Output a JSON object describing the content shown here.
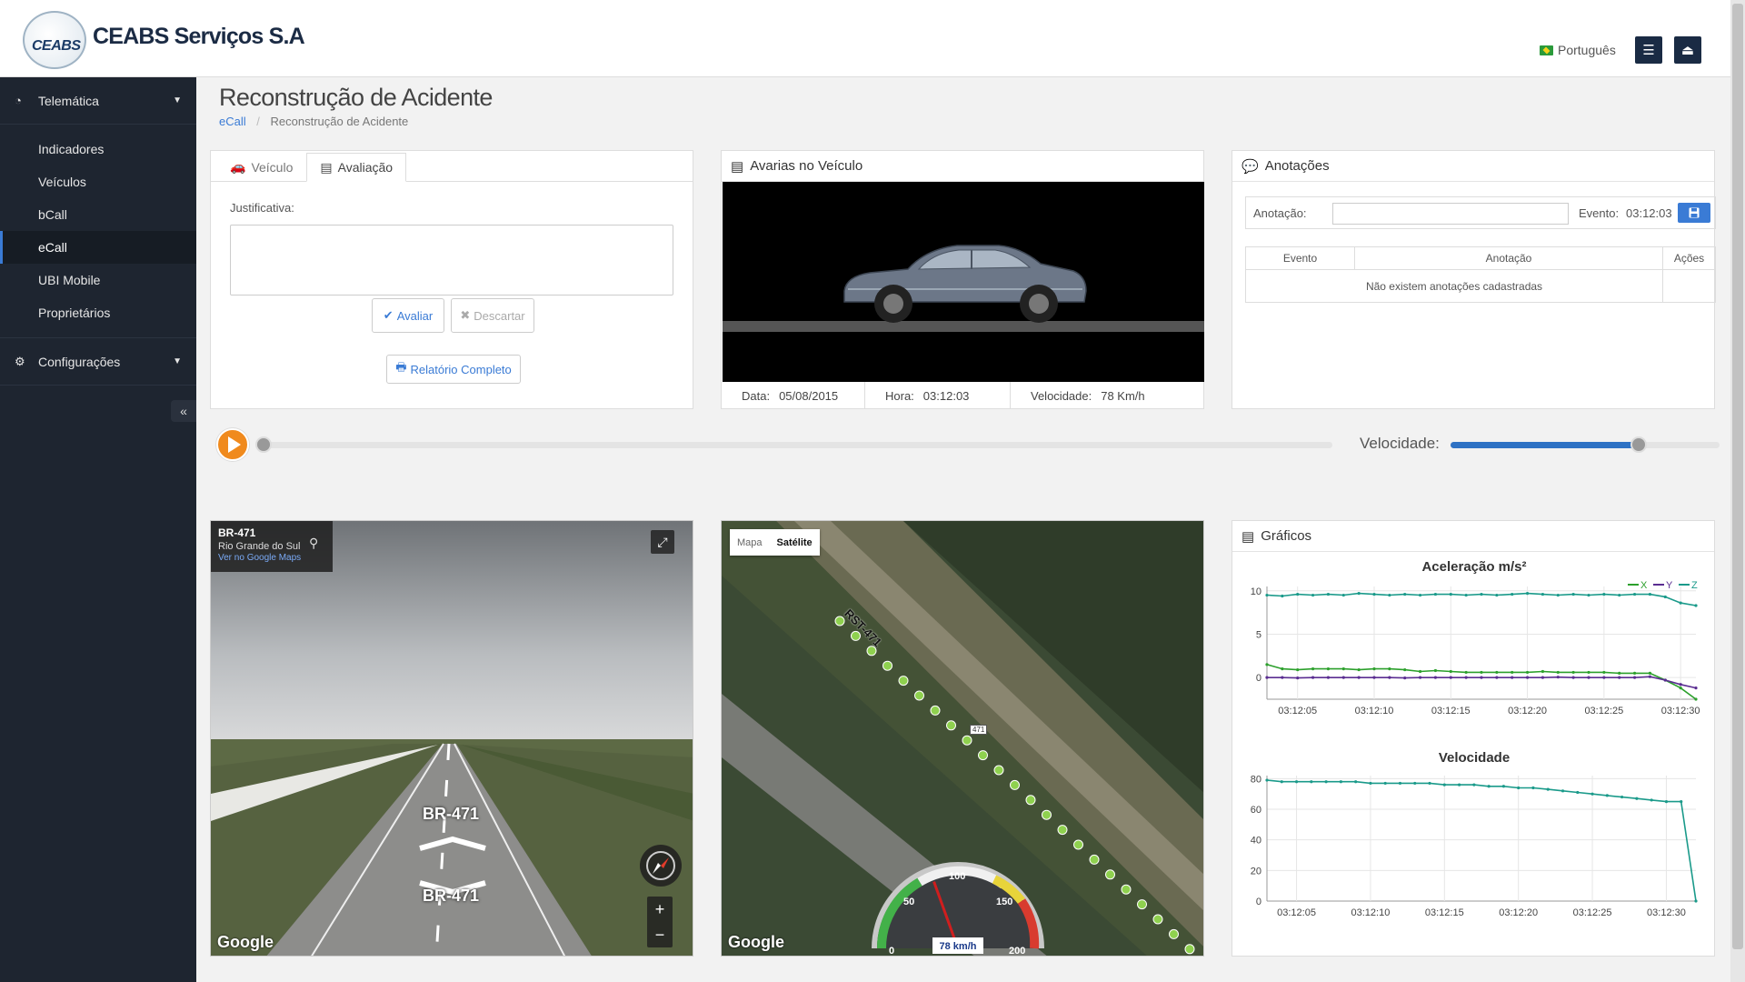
{
  "header": {
    "logo_text": "CEABS",
    "company": "CEABS Serviços S.A",
    "language": "Português"
  },
  "sidebar": {
    "sections": [
      {
        "label": "Telemática",
        "icon": "dashboard-icon"
      },
      {
        "label": "Configurações",
        "icon": "cogs-icon"
      }
    ],
    "items": [
      "Indicadores",
      "Veículos",
      "bCall",
      "eCall",
      "UBI Mobile",
      "Proprietários"
    ],
    "active_item": "eCall"
  },
  "page": {
    "title": "Reconstrução de Acidente",
    "breadcrumb": [
      "eCall",
      "Reconstrução de Acidente"
    ]
  },
  "evaluation": {
    "tabs": [
      "Veículo",
      "Avaliação"
    ],
    "active_tab": "Avaliação",
    "justification_label": "Justificativa:",
    "justification_value": "",
    "evaluate_label": "Avaliar",
    "discard_label": "Descartar",
    "report_label": "Relatório Completo"
  },
  "damage": {
    "title": "Avarias no Veículo",
    "date_label": "Data:",
    "date_value": "05/08/2015",
    "time_label": "Hora:",
    "time_value": "03:12:03",
    "speed_label": "Velocidade:",
    "speed_value": "78 Km/h"
  },
  "annotations": {
    "title": "Anotações",
    "input_label": "Anotação:",
    "input_value": "",
    "event_label": "Evento:",
    "event_value": "03:12:03",
    "columns": [
      "Evento",
      "Anotação",
      "Ações"
    ],
    "empty_message": "Não existem anotações cadastradas"
  },
  "playback": {
    "speed_label": "Velocidade:",
    "position_fraction": 0.0,
    "speed_fraction": 0.7
  },
  "streetview": {
    "road": "BR-471",
    "region": "Rio Grande do Sul",
    "link": "Ver no Google Maps",
    "marker_top": "BR-471",
    "marker_bottom": "BR-471",
    "brand": "Google"
  },
  "satellite": {
    "map_label": "Mapa",
    "satellite_label": "Satélite",
    "road_label": "RST-471",
    "shield_label": "471",
    "brand": "Google",
    "gauge": {
      "ticks": [
        "0",
        "50",
        "100",
        "150",
        "200"
      ],
      "value": 78,
      "max": 200,
      "readout": "78 km/h"
    }
  },
  "charts": {
    "title": "Gráficos",
    "legend_colors": {
      "X": "#2ca02c",
      "Y": "#5a2d91",
      "Z": "#1a9a8a"
    }
  },
  "chart_data": [
    {
      "type": "line",
      "title": "Aceleração m/s²",
      "x": [
        "03:12:03",
        "03:12:04",
        "03:12:05",
        "03:12:06",
        "03:12:07",
        "03:12:08",
        "03:12:09",
        "03:12:10",
        "03:12:11",
        "03:12:12",
        "03:12:13",
        "03:12:14",
        "03:12:15",
        "03:12:16",
        "03:12:17",
        "03:12:18",
        "03:12:19",
        "03:12:20",
        "03:12:21",
        "03:12:22",
        "03:12:23",
        "03:12:24",
        "03:12:25",
        "03:12:26",
        "03:12:27",
        "03:12:28",
        "03:12:29",
        "03:12:30",
        "03:12:31"
      ],
      "xticks": [
        "03:12:05",
        "03:12:10",
        "03:12:15",
        "03:12:20",
        "03:12:25",
        "03:12:30"
      ],
      "yticks": [
        0,
        5,
        10
      ],
      "ylim": [
        -2.5,
        10.5
      ],
      "series": [
        {
          "name": "X",
          "values": [
            1.5,
            1.0,
            0.9,
            1.0,
            1.0,
            1.0,
            0.9,
            1.0,
            1.0,
            0.9,
            0.7,
            0.8,
            0.7,
            0.6,
            0.6,
            0.6,
            0.6,
            0.6,
            0.7,
            0.6,
            0.6,
            0.6,
            0.6,
            0.5,
            0.5,
            0.5,
            -0.3,
            -1.2,
            -2.5
          ]
        },
        {
          "name": "Y",
          "values": [
            0.0,
            0.0,
            -0.05,
            0.0,
            0.0,
            0.0,
            0.0,
            0.0,
            0.0,
            -0.05,
            0.0,
            0.0,
            0.0,
            0.0,
            0.0,
            0.0,
            0.0,
            0.0,
            0.0,
            0.05,
            0.0,
            0.0,
            0.0,
            0.0,
            0.0,
            0.1,
            -0.3,
            -0.8,
            -1.2
          ]
        },
        {
          "name": "Z",
          "values": [
            9.5,
            9.4,
            9.6,
            9.5,
            9.6,
            9.5,
            9.7,
            9.6,
            9.5,
            9.6,
            9.5,
            9.6,
            9.6,
            9.5,
            9.6,
            9.5,
            9.6,
            9.7,
            9.6,
            9.5,
            9.6,
            9.5,
            9.6,
            9.5,
            9.6,
            9.6,
            9.3,
            8.6,
            8.3
          ]
        }
      ]
    },
    {
      "type": "line",
      "title": "Velocidade",
      "x": [
        "03:12:03",
        "03:12:04",
        "03:12:05",
        "03:12:06",
        "03:12:07",
        "03:12:08",
        "03:12:09",
        "03:12:10",
        "03:12:11",
        "03:12:12",
        "03:12:13",
        "03:12:14",
        "03:12:15",
        "03:12:16",
        "03:12:17",
        "03:12:18",
        "03:12:19",
        "03:12:20",
        "03:12:21",
        "03:12:22",
        "03:12:23",
        "03:12:24",
        "03:12:25",
        "03:12:26",
        "03:12:27",
        "03:12:28",
        "03:12:29",
        "03:12:30",
        "03:12:31",
        "03:12:32"
      ],
      "xticks": [
        "03:12:05",
        "03:12:10",
        "03:12:15",
        "03:12:20",
        "03:12:25",
        "03:12:30"
      ],
      "yticks": [
        0,
        20,
        40,
        60,
        80
      ],
      "ylim": [
        0,
        82
      ],
      "series": [
        {
          "name": "Velocidade",
          "values": [
            79,
            78,
            78,
            78,
            78,
            78,
            78,
            77,
            77,
            77,
            77,
            77,
            76,
            76,
            76,
            75,
            75,
            74,
            74,
            73,
            72,
            71,
            70,
            69,
            68,
            67,
            66,
            65,
            65,
            0
          ]
        }
      ]
    }
  ]
}
